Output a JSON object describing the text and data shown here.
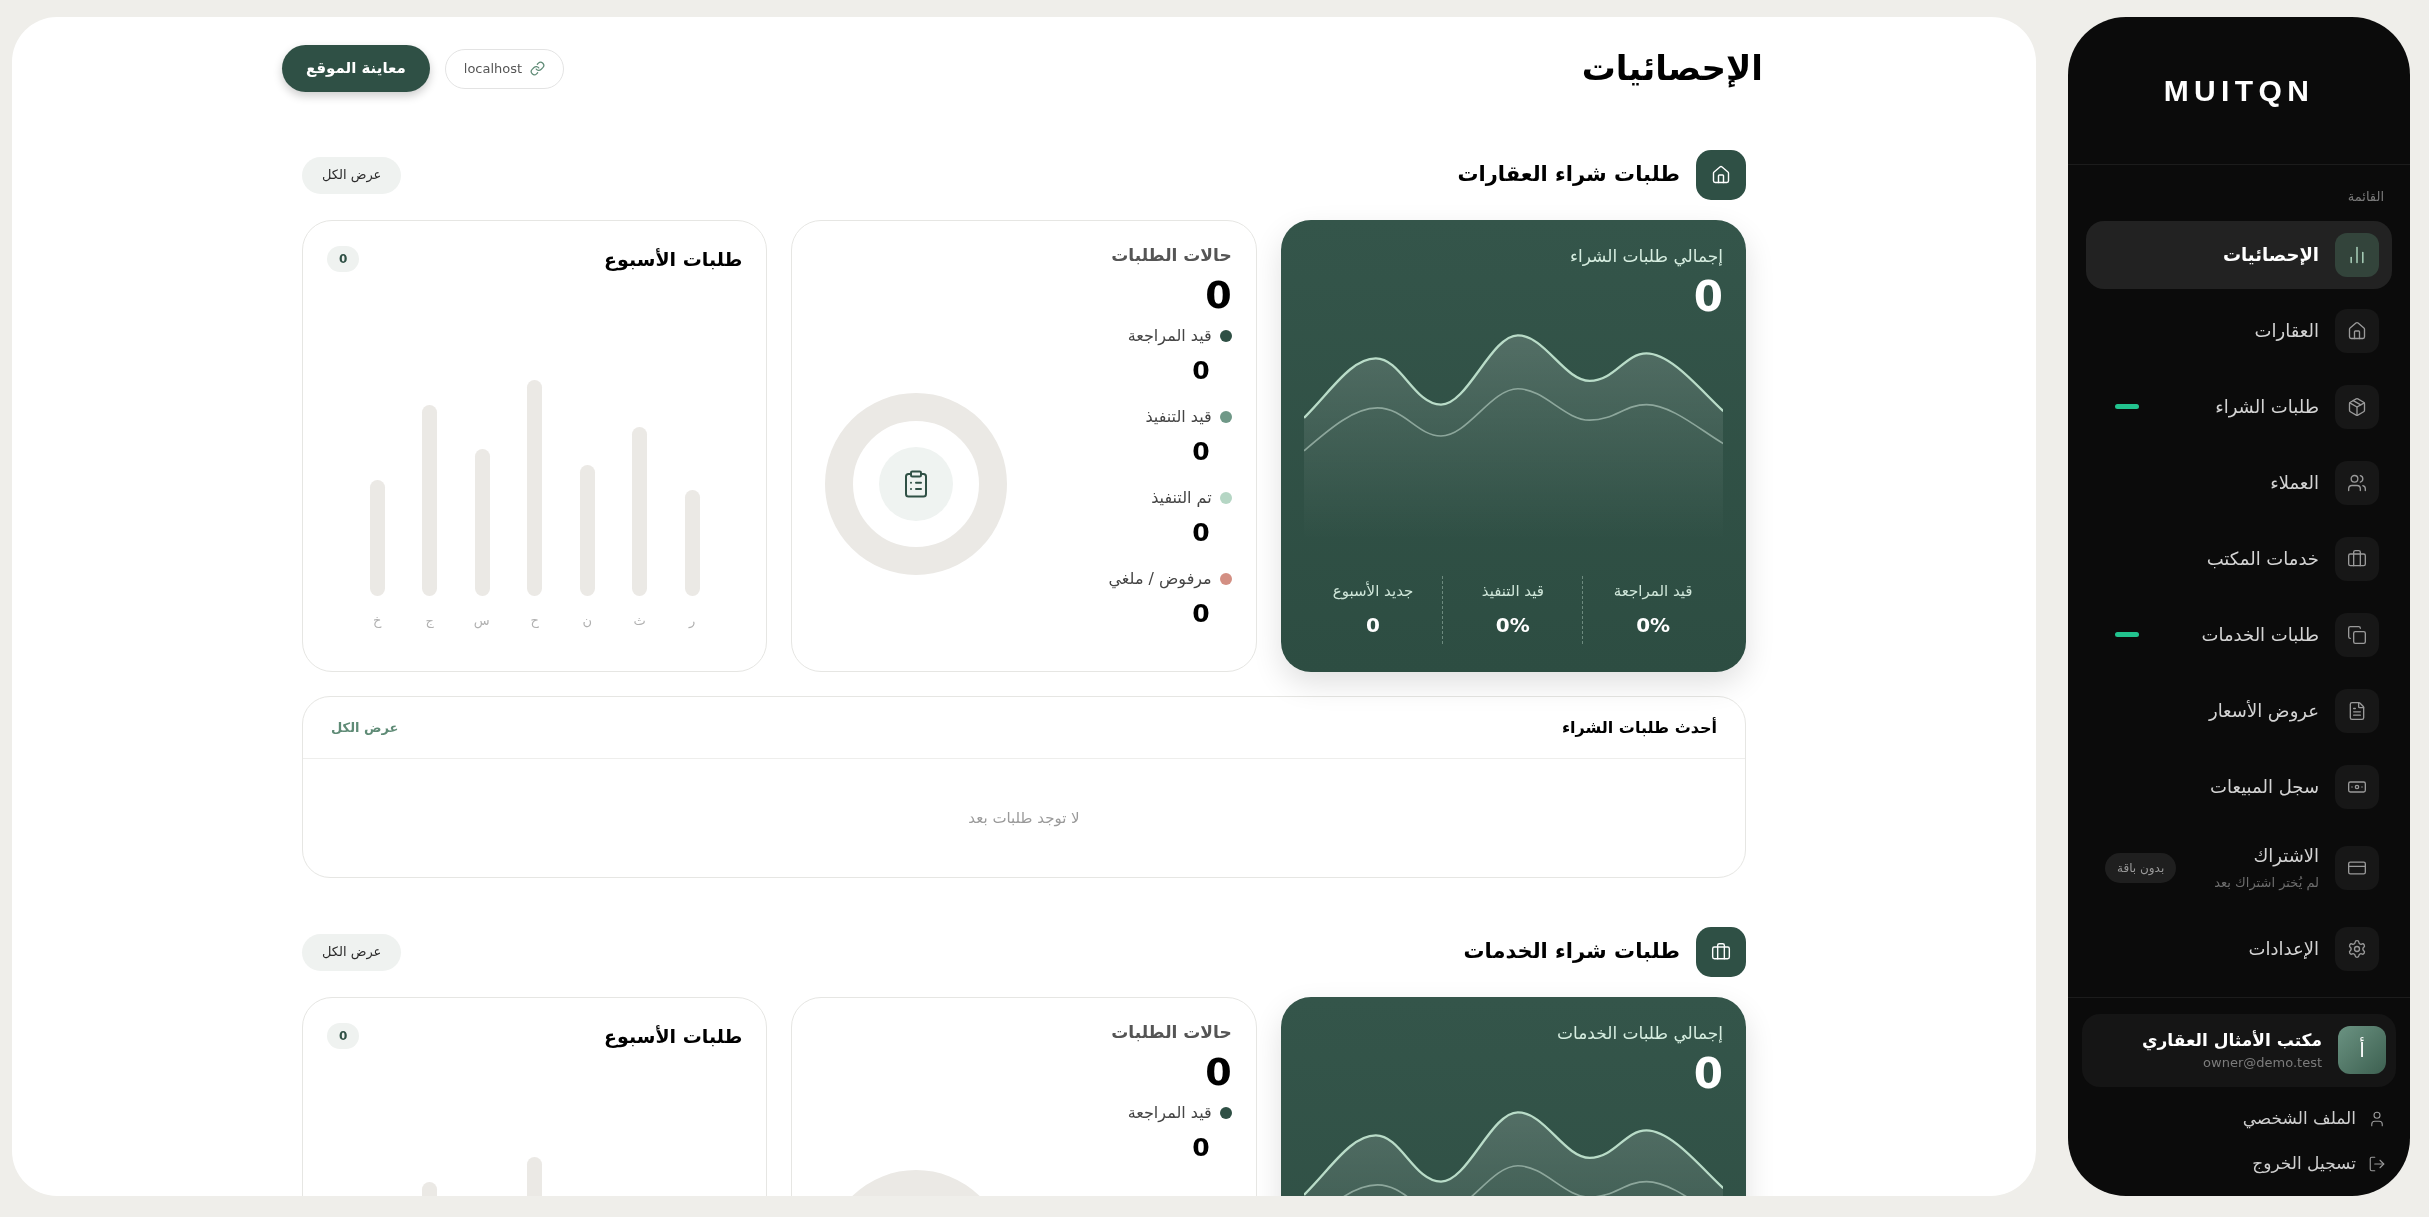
{
  "sidebar": {
    "brand": "MUITQN",
    "menu_label": "القائمة",
    "items": [
      {
        "label": "الإحصائيات",
        "selected": true,
        "indicator": false
      },
      {
        "label": "العقارات",
        "selected": false,
        "indicator": false
      },
      {
        "label": "طلبات الشراء",
        "selected": false,
        "indicator": true
      },
      {
        "label": "العملاء",
        "selected": false,
        "indicator": false
      },
      {
        "label": "خدمات المكتب",
        "selected": false,
        "indicator": false
      },
      {
        "label": "طلبات الخدمات",
        "selected": false,
        "indicator": true
      },
      {
        "label": "عروض الأسعار",
        "selected": false,
        "indicator": false
      },
      {
        "label": "سجل المبيعات",
        "selected": false,
        "indicator": false
      },
      {
        "label": "الاشتراك",
        "subtitle": "لم يُختر اشتراك بعد",
        "tag": "بدون باقة",
        "selected": false,
        "indicator": false
      },
      {
        "label": "الإعدادات",
        "selected": false,
        "indicator": false
      }
    ],
    "user": {
      "avatar": "أ",
      "name": "مكتب الأمثال العقاري",
      "email": "owner@demo.test"
    },
    "footer_links": [
      "الملف الشخصي",
      "تسجيل الخروج"
    ]
  },
  "page": {
    "title": "الإحصائيات",
    "url": "localhost",
    "preview_button": "معاينة الموقع"
  },
  "sections": [
    {
      "title": "طلبات شراء العقارات",
      "view_all": "عرض الكل",
      "total": {
        "title": "إجمالي طلبات الشراء",
        "value": "0",
        "stats": [
          {
            "label": "قيد المراجعة",
            "value": "0%"
          },
          {
            "label": "قيد التنفيذ",
            "value": "0%"
          },
          {
            "label": "جديد الأسبوع",
            "value": "0"
          }
        ]
      },
      "statuses": {
        "title": "حالات الطلبات",
        "value": "0",
        "items": [
          {
            "label": "قيد المراجعة",
            "value": "0",
            "color": "#2f5045"
          },
          {
            "label": "قيد التنفيذ",
            "value": "0",
            "color": "#6f9887"
          },
          {
            "label": "تم التنفيذ",
            "value": "0",
            "color": "#b5d6c4"
          },
          {
            "label": "مرفوض / ملغي",
            "value": "0",
            "color": "#d38f83"
          }
        ]
      },
      "week": {
        "title": "طلبات الأسبوع",
        "badge": "0",
        "days": [
          "ر",
          "ث",
          "ن",
          "ح",
          "س",
          "ج",
          "خ"
        ]
      },
      "latest": {
        "title": "أحدث طلبات الشراء",
        "view_all": "عرض الكل",
        "empty": "لا توجد طلبات بعد"
      }
    },
    {
      "title": "طلبات شراء الخدمات",
      "view_all": "عرض الكل",
      "total": {
        "title": "إجمالي طلبات الخدمات",
        "value": "0"
      },
      "statuses": {
        "title": "حالات الطلبات",
        "value": "0",
        "items": [
          {
            "label": "قيد المراجعة",
            "value": "0",
            "color": "#2f5045"
          }
        ]
      },
      "week": {
        "title": "طلبات الأسبوع",
        "badge": "0"
      }
    }
  ]
}
